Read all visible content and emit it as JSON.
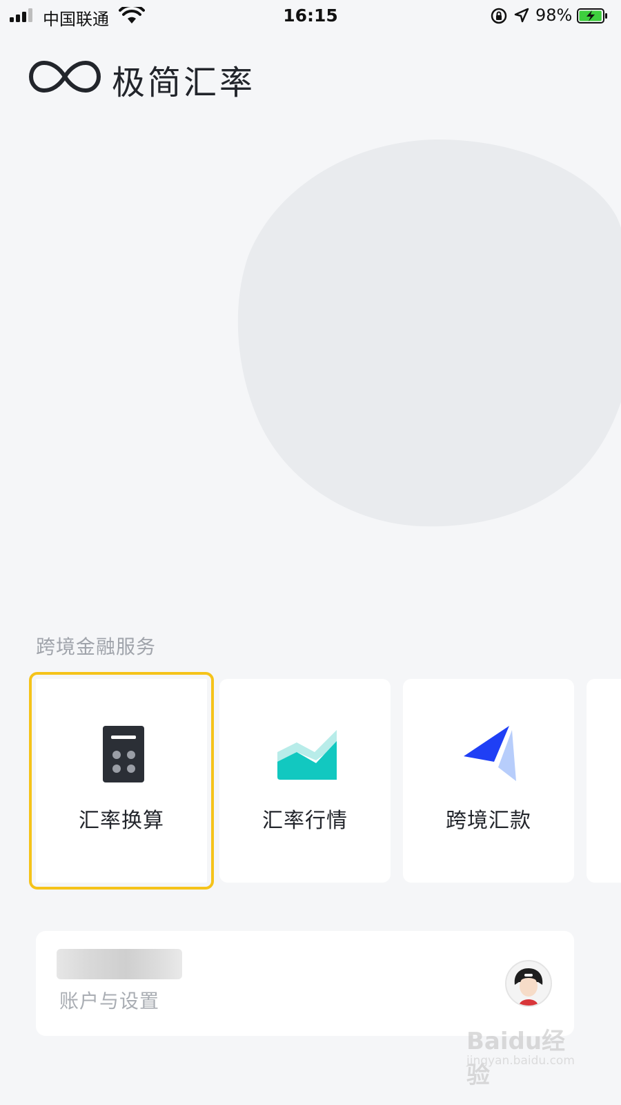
{
  "status_bar": {
    "carrier": "中国联通",
    "time": "16:15",
    "battery_percent": "98%",
    "battery_level": 0.98,
    "icons": [
      "signal-icon",
      "wifi-icon",
      "rotation-lock-icon",
      "location-icon",
      "battery-charging-icon"
    ]
  },
  "header": {
    "app_title": "极简汇率",
    "logo_icon": "infinity-logo-icon"
  },
  "services": {
    "section_title": "跨境金融服务",
    "items": [
      {
        "label": "汇率换算",
        "icon": "calculator-icon",
        "selected": true
      },
      {
        "label": "汇率行情",
        "icon": "trend-chart-icon",
        "selected": false
      },
      {
        "label": "跨境汇款",
        "icon": "paper-plane-icon",
        "selected": false
      }
    ]
  },
  "account": {
    "label": "账户与设置",
    "avatar_icon": "avatar-icon"
  },
  "watermark": {
    "brand": "Baidu经验",
    "url": "jingyan.baidu.com"
  },
  "colors": {
    "background": "#f5f6f8",
    "card": "#ffffff",
    "selection_outline": "#f5c31a",
    "teal": "#12c8c0",
    "blue": "#1f3ff5",
    "light_blue": "#b7cdfb",
    "dark_icon": "#2b2f36"
  }
}
